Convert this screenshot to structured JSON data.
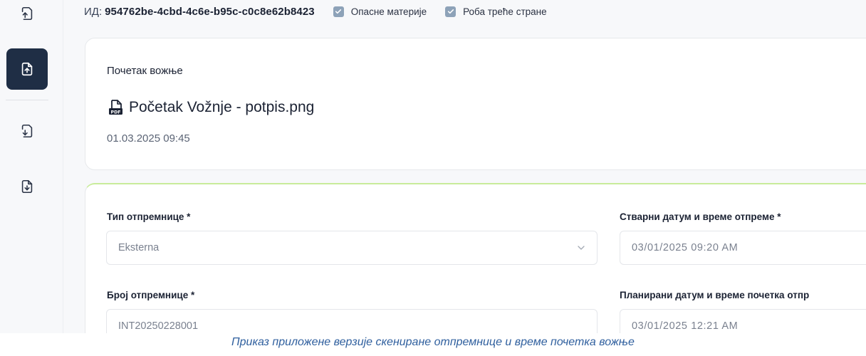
{
  "sidebar": {
    "items": [
      {
        "icon": "file-export-icon"
      },
      {
        "icon": "file-upload-icon",
        "active": true
      },
      {
        "icon": "file-import-icon"
      },
      {
        "icon": "file-download-icon"
      }
    ]
  },
  "header": {
    "id_label": "ИД:",
    "id_value": "954762be-4cbd-4c6e-b95c-c0c8e62b8423",
    "checkbox_hazardous": "Опасне материје",
    "checkbox_third_party": "Роба треће стране"
  },
  "start_card": {
    "title": "Почетак вожње",
    "file_name": "Početak Vožnje - potpis.png",
    "file_icon": "pdf-file-icon",
    "date": "01.03.2025 09:45"
  },
  "form": {
    "type_label": "Тип отпремнице *",
    "type_value": "Eksterna",
    "actual_datetime_label": "Стварни датум и време отпреме *",
    "actual_datetime_value": "03/01/2025 09:20 AM",
    "number_label": "Број отпремнице *",
    "number_value": "INT20250228001",
    "planned_datetime_label": "Планирани датум и време почетка отпр",
    "planned_datetime_value": "03/01/2025 12:21 AM"
  },
  "caption": "Приказ приложене верзије скениране отпремнице и време почетка вожње",
  "colors": {
    "sidebar_active": "#1f2e45",
    "checkbox": "#8da2b8",
    "accent_border": "#c8ec9a",
    "caption": "#2f5f9e"
  }
}
